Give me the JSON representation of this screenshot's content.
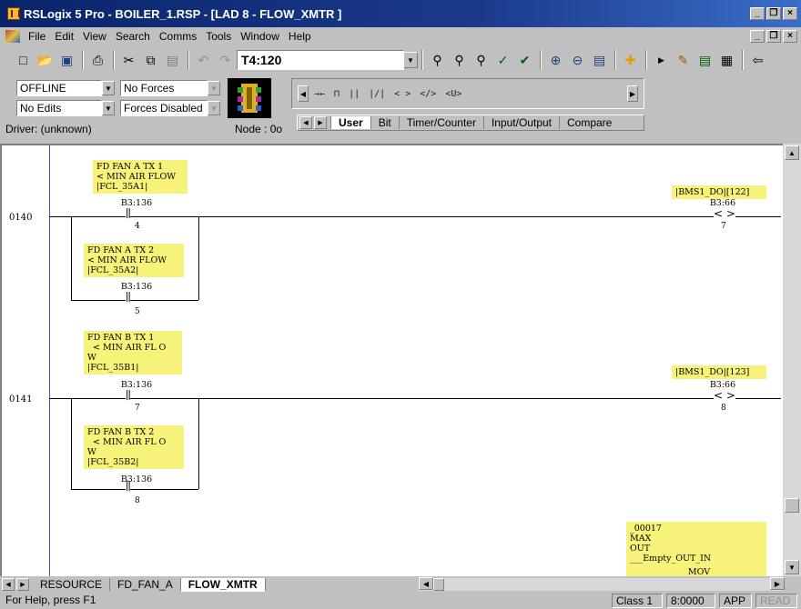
{
  "window": {
    "title": "RSLogix 5 Pro - BOILER_1.RSP - [LAD 8 - FLOW_XMTR ]",
    "buttons": [
      "_",
      "❒",
      "×"
    ]
  },
  "menu": {
    "items": [
      "File",
      "Edit",
      "View",
      "Search",
      "Comms",
      "Tools",
      "Window",
      "Help"
    ],
    "mdi_buttons": [
      "_",
      "❒",
      "×"
    ]
  },
  "toolbar": {
    "address_value": "T4:120",
    "icons": [
      "new-file-icon",
      "open-folder-icon",
      "save-icon",
      "print-icon",
      "cut-icon",
      "copy-icon",
      "paste-icon",
      "undo-icon",
      "redo-icon"
    ],
    "right_icons": [
      "find-icon",
      "find-next-icon",
      "replace-icon",
      "verify-icon",
      "verify-all-icon",
      "zoom-in-icon",
      "zoom-out-icon",
      "window-icon",
      "add-icon",
      "run-icon",
      "edit-icon",
      "chart-icon",
      "properties-icon",
      "back-icon"
    ]
  },
  "status": {
    "mode": "OFFLINE",
    "forces": "No Forces",
    "edits": "No Edits",
    "forces_enabled": "Forces Disabled",
    "driver": "Driver: (unknown)",
    "node": "Node : 0o"
  },
  "instructions": {
    "symbols": [
      "→←",
      "⊓",
      "∣∣",
      "∣/∣",
      "< >",
      "<∕>",
      "<U>"
    ],
    "tabs": [
      "User",
      "Bit",
      "Timer/Counter",
      "Input/Output",
      "Compare"
    ],
    "active_tab": "User"
  },
  "ladder": {
    "rungs": [
      {
        "number": "0140",
        "branches": [
          {
            "description": "FD FAN A TX 1\n< MIN AIR FLOW\n|FCL_35A1|",
            "address": "B3:136",
            "bit": "4"
          },
          {
            "description": "FD FAN A TX 2\n< MIN AIR FLOW\n|FCL_35A2|",
            "address": "B3:136",
            "bit": "5"
          }
        ],
        "output": {
          "description": "|BMS1_DO|[122]",
          "address": "B3:66",
          "bit": "7"
        }
      },
      {
        "number": "0141",
        "branches": [
          {
            "description": "FD FAN B TX 1\n  < MIN AIR FL O\nW\n|FCL_35B1|",
            "address": "B3:136",
            "bit": "7"
          },
          {
            "description": "FD FAN B TX 2\n  < MIN AIR FL O\nW\n|FCL_35B2|",
            "address": "B3:136",
            "bit": "8"
          }
        ],
        "output": {
          "description": "|BMS1_DO|[123]",
          "address": "B3:66",
          "bit": "8"
        }
      }
    ],
    "next_block": {
      "description": "_00017\nMAX\nOUT\n___Empty_OUT_IN",
      "instruction": "MOV"
    }
  },
  "file_tabs": {
    "tabs": [
      "RESOURCE",
      "FD_FAN_A",
      "FLOW_XMTR"
    ],
    "active": "FLOW_XMTR"
  },
  "statusbar": {
    "help": "For Help, press F1",
    "class": "Class 1",
    "address": "8:0000",
    "app": "APP",
    "read": "READ"
  },
  "colors": {
    "title_bar": "#0a246a",
    "desc_background": "#f7f27a",
    "rail": "#4060a0"
  }
}
